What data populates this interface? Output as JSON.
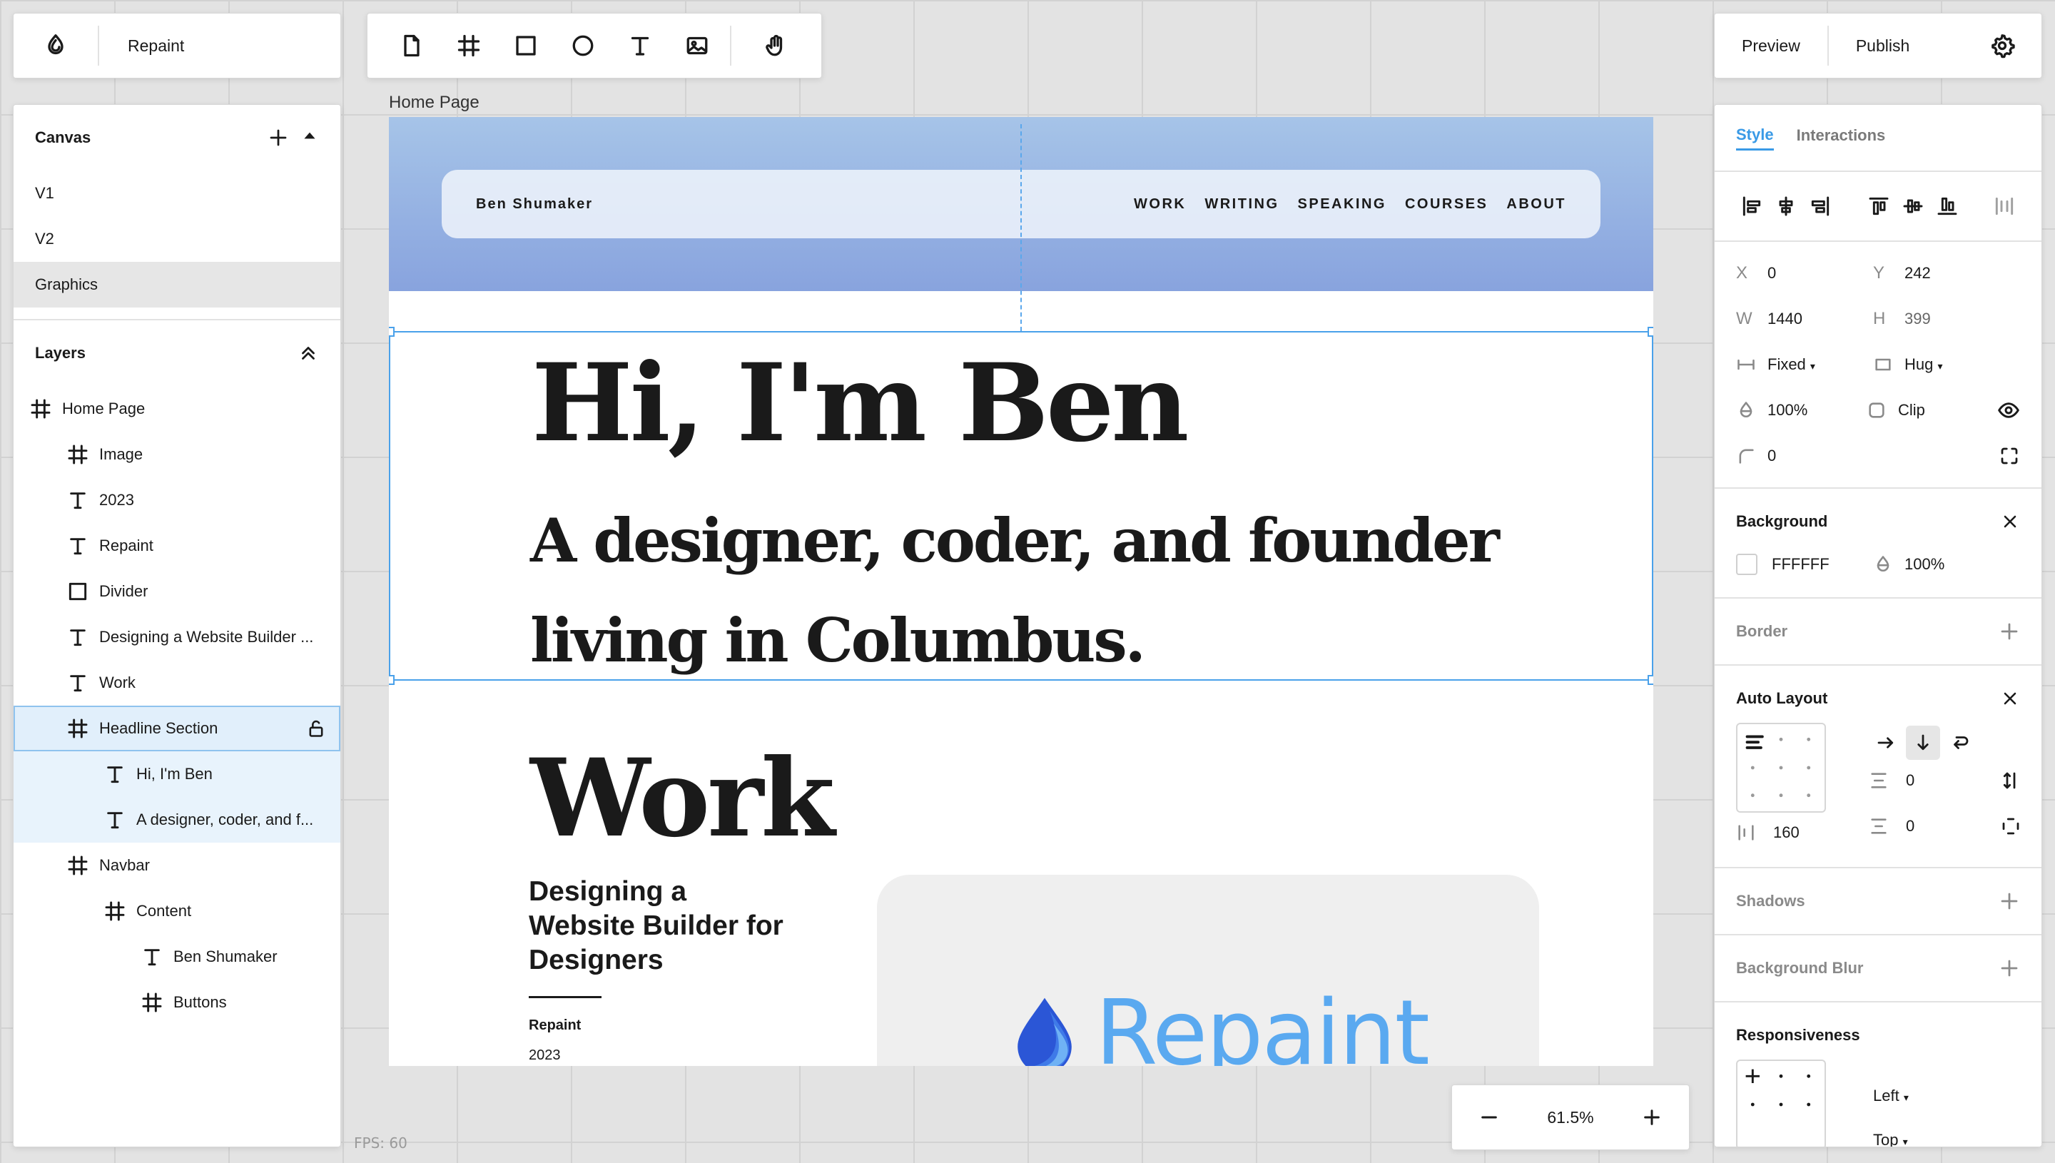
{
  "app": {
    "title": "Repaint"
  },
  "topbar": {
    "preview": "Preview",
    "publish": "Publish"
  },
  "canvas_panel": {
    "title": "Canvas",
    "pages": [
      "V1",
      "V2",
      "Graphics"
    ]
  },
  "layers_panel": {
    "title": "Layers",
    "items": [
      {
        "name": "Home Page",
        "type": "frame",
        "depth": 0
      },
      {
        "name": "Image",
        "type": "frame",
        "depth": 1
      },
      {
        "name": "2023",
        "type": "text",
        "depth": 1
      },
      {
        "name": "Repaint",
        "type": "text",
        "depth": 1
      },
      {
        "name": "Divider",
        "type": "rect",
        "depth": 1
      },
      {
        "name": "Designing a Website Builder ...",
        "type": "text",
        "depth": 1
      },
      {
        "name": "Work",
        "type": "text",
        "depth": 1
      },
      {
        "name": "Headline Section",
        "type": "frame",
        "depth": 1
      },
      {
        "name": "Hi, I'm Ben",
        "type": "text",
        "depth": 2
      },
      {
        "name": "A designer, coder, and f...",
        "type": "text",
        "depth": 2
      },
      {
        "name": "Navbar",
        "type": "frame",
        "depth": 1
      },
      {
        "name": "Content",
        "type": "frame",
        "depth": 2
      },
      {
        "name": "Ben Shumaker",
        "type": "text",
        "depth": 3
      },
      {
        "name": "Buttons",
        "type": "frame",
        "depth": 3
      }
    ]
  },
  "status": {
    "fps": "FPS: 60"
  },
  "artboard": {
    "label": "Home Page",
    "navbar": {
      "brand": "Ben Shumaker",
      "links": [
        "WORK",
        "WRITING",
        "SPEAKING",
        "COURSES",
        "ABOUT"
      ]
    },
    "headline": "Hi, I'm Ben",
    "subheadline": "A designer, coder, and founder living in Columbus.",
    "work_heading": "Work",
    "project": {
      "title": "Designing a Website Builder for Designers",
      "name": "Repaint",
      "year": "2023",
      "image_word": "Repaint"
    }
  },
  "zoom": {
    "value": "61.5%"
  },
  "inspector": {
    "tabs": [
      "Style",
      "Interactions"
    ],
    "x_label": "X",
    "x": "0",
    "y_label": "Y",
    "y": "242",
    "w_label": "W",
    "w": "1440",
    "h_label": "H",
    "h": "399",
    "width_mode": "Fixed",
    "height_mode": "Hug",
    "opacity": "100%",
    "clip": "Clip",
    "radius": "0",
    "background": {
      "title": "Background",
      "color": "FFFFFF",
      "opacity": "100%"
    },
    "border": {
      "title": "Border"
    },
    "auto_layout": {
      "title": "Auto Layout",
      "gap": "0",
      "padding_v": "0",
      "padding_h": "160"
    },
    "shadows": {
      "title": "Shadows"
    },
    "background_blur": {
      "title": "Background Blur"
    },
    "responsiveness": {
      "title": "Responsiveness",
      "horizontal": "Left",
      "vertical": "Top"
    }
  },
  "colors": {
    "accent": "#3a9ae6",
    "selection": "#4aa1ea",
    "hero_top": "#a6c4e8",
    "hero_bottom": "#88a3de"
  }
}
